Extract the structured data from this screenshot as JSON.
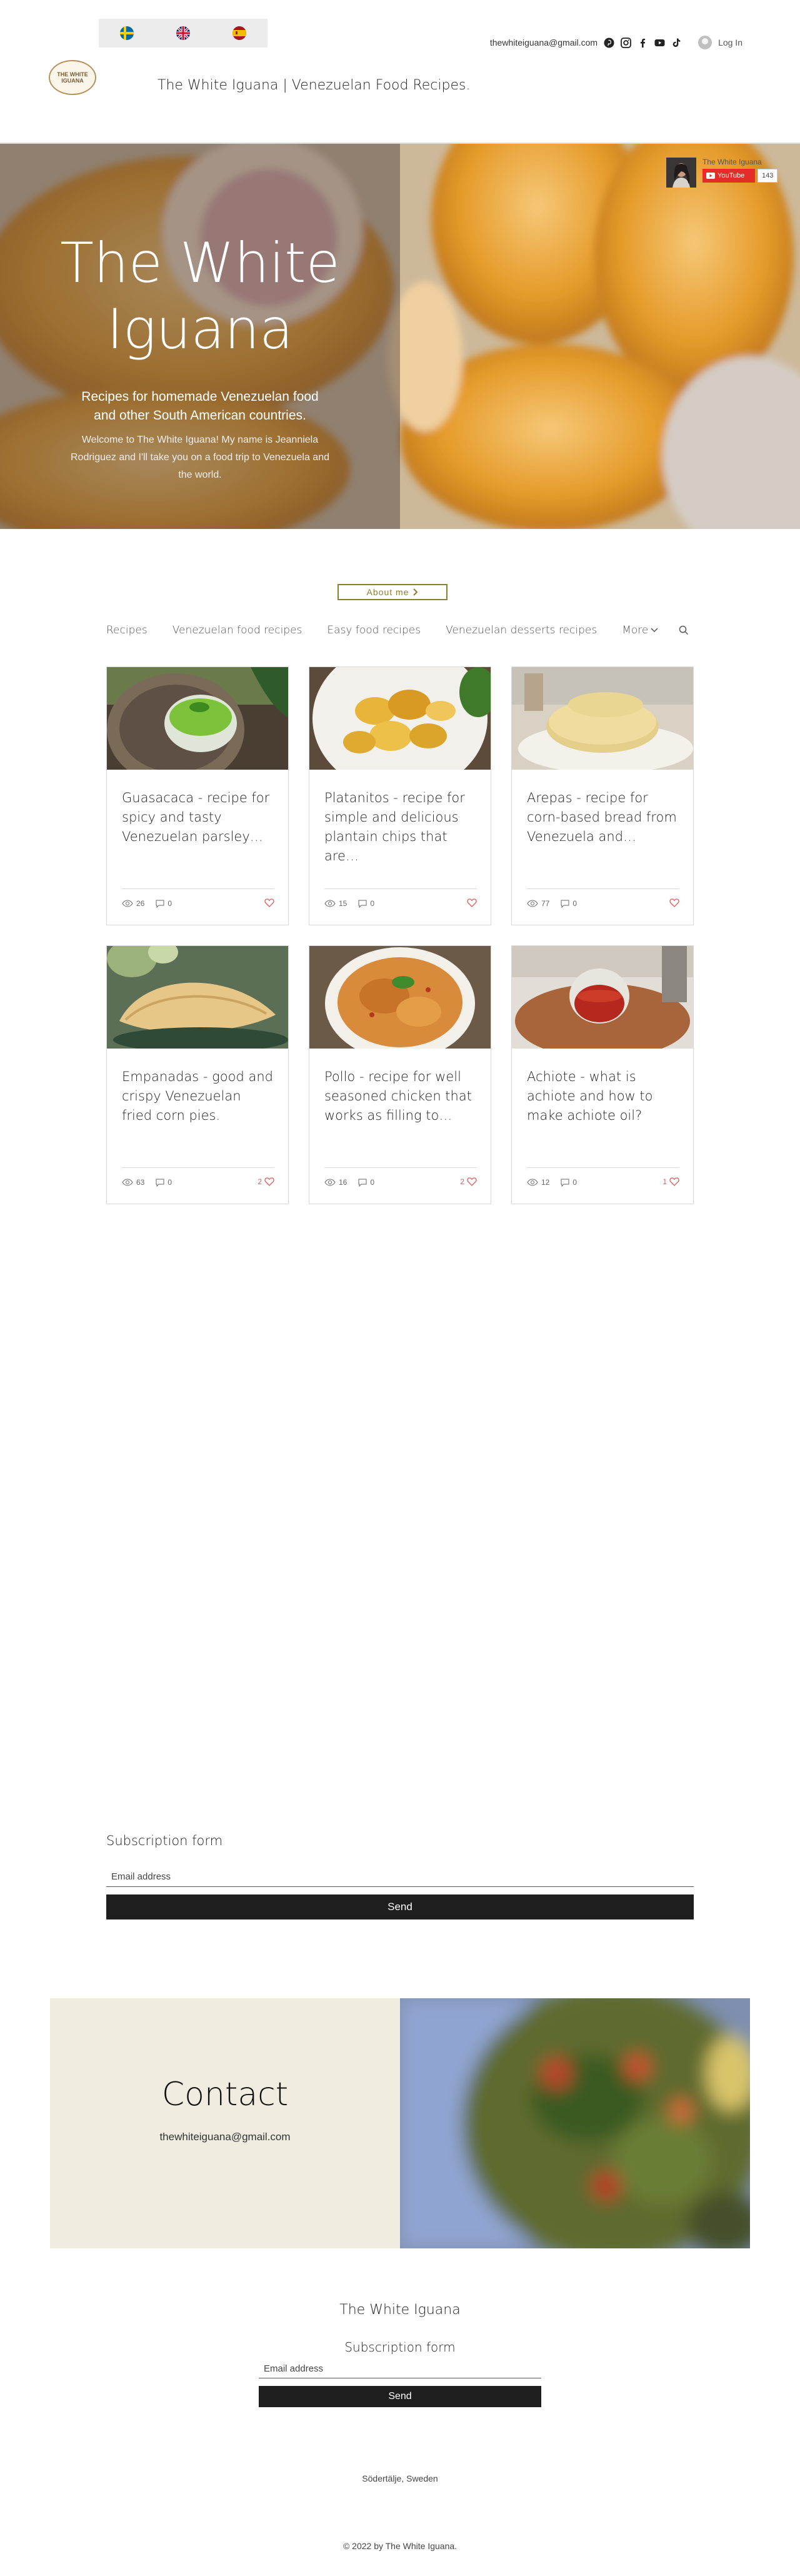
{
  "header": {
    "languages": [
      {
        "name": "Swedish",
        "icon": "flag-sweden-icon"
      },
      {
        "name": "English",
        "icon": "flag-uk-icon"
      },
      {
        "name": "Spanish",
        "icon": "flag-spain-icon"
      }
    ],
    "logo_text": "THE WHITE IGUANA",
    "site_title": "The White Iguana | Venezuelan Food Recipes.",
    "email": "thewhiteiguana@gmail.com",
    "social_icons": [
      "pinterest-icon",
      "instagram-icon",
      "facebook-icon",
      "youtube-icon",
      "tiktok-icon"
    ],
    "login_label": "Log In"
  },
  "hero": {
    "title": "The White Iguana",
    "subtitle": "Recipes for homemade Venezuelan food and other South American countries.",
    "intro": "Welcome to The White Iguana!  My name is Jeanniela Rodriguez and I'll take you on  a food trip to Venezuela and the world.",
    "youtube": {
      "channel": "The White Iguana",
      "button_label": "YouTube",
      "subscriber_count": "143"
    }
  },
  "about_button": {
    "label": "About me"
  },
  "blog_nav": {
    "items": [
      "Recipes",
      "Venezuelan food recipes",
      "Easy food recipes",
      "Venezuelan desserts recipes"
    ],
    "more_label": "More"
  },
  "posts": [
    {
      "title": "Guasacaca - recipe for spicy and tasty Venezuelan parsley…",
      "views": "26",
      "comments": "0",
      "likes": ""
    },
    {
      "title": "Platanitos - recipe for simple and delicious plantain chips that are…",
      "views": "15",
      "comments": "0",
      "likes": ""
    },
    {
      "title": "Arepas - recipe for corn-based bread from Venezuela and…",
      "views": "77",
      "comments": "0",
      "likes": ""
    },
    {
      "title": "Empanadas - good and crispy Venezuelan fried corn pies.",
      "views": "63",
      "comments": "0",
      "likes": "2"
    },
    {
      "title": "Pollo - recipe for well seasoned chicken that works as filling to…",
      "views": "16",
      "comments": "0",
      "likes": "2"
    },
    {
      "title": "Achiote - what is achiote and how to make achiote oil?",
      "views": "12",
      "comments": "0",
      "likes": "1"
    }
  ],
  "subscription": {
    "title": "Subscription form",
    "placeholder": "Email address",
    "button_label": "Send"
  },
  "contact": {
    "title": "Contact",
    "email": "thewhiteiguana@gmail.com"
  },
  "footer": {
    "name": "The White Iguana",
    "subscription_title": "Subscription form",
    "placeholder": "Email address",
    "button_label": "Send",
    "location": "Södertälje, Sweden",
    "copyright": "© 2022  by The White Iguana."
  },
  "colors": {
    "accent": "#8a7f2e",
    "like": "#e05a5a",
    "send_button": "#1e1e1e",
    "contact_bg": "#f0ece0",
    "youtube_red": "#e52d27"
  }
}
